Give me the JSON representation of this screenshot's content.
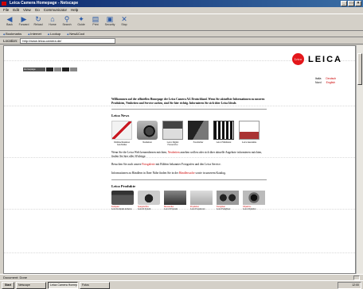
{
  "window": {
    "title": "Leica Camera Homepage - Netscape"
  },
  "menu": [
    "File",
    "Edit",
    "View",
    "Go",
    "Communicator",
    "Help"
  ],
  "toolbar": [
    {
      "label": "Back",
      "icon": "back-icon",
      "glyph": "◀"
    },
    {
      "label": "Forward",
      "icon": "forward-icon",
      "glyph": "▶"
    },
    {
      "label": "Reload",
      "icon": "reload-icon",
      "glyph": "↻"
    },
    {
      "label": "Home",
      "icon": "home-icon",
      "glyph": "⌂"
    },
    {
      "label": "Search",
      "icon": "search-icon",
      "glyph": "⚲"
    },
    {
      "label": "Guide",
      "icon": "guide-icon",
      "glyph": "✦"
    },
    {
      "label": "Print",
      "icon": "print-icon",
      "glyph": "▤"
    },
    {
      "label": "Security",
      "icon": "lock-icon",
      "glyph": "▣"
    },
    {
      "label": "Stop",
      "icon": "stop-icon",
      "glyph": "✕"
    }
  ],
  "links_bar": [
    "Bookmarks",
    "Internet",
    "Lookup",
    "New&Cool"
  ],
  "address": {
    "label": "Location:",
    "value": "http://www.leica-camera.de/"
  },
  "brand": {
    "name": "LEICA",
    "badge": "Leica"
  },
  "nav": {
    "first_label": "Homepage"
  },
  "languages": [
    [
      "Italia",
      "Deutsch"
    ],
    [
      "Nord",
      "English"
    ]
  ],
  "intro": "Willkommen auf der offiziellen Homepage der Leica Camera AG Deutschland. Wenn Sie aktuellste Informationen zu unseren Produkten, Neuheiten und Service suchen, sind Sie hier richtig. Informieren Sie sich über Leica Ideale.",
  "news": {
    "heading": "Leica News",
    "items": [
      {
        "caption": "Weihnachtsaktion Geschenke",
        "img": "img-gift"
      },
      {
        "caption": "Neuheiten",
        "img": "img-camera"
      },
      {
        "caption": "Leica Digital Fotoservice",
        "img": "img-printer"
      },
      {
        "caption": "Fotobücher",
        "img": "img-album"
      },
      {
        "caption": "Leica Filmdienst",
        "img": "img-film"
      },
      {
        "caption": "Leica Akademie",
        "img": "img-doc"
      }
    ]
  },
  "body_text": [
    {
      "pre": "Wenn Sie die Leica Welt kennenlernen möchten, ",
      "link": "Neuheiten",
      "post": " ansehen wollen oder sich über aktuelle Angebote informieren möchten, finden Sie hier alles Wichtige."
    },
    {
      "pre": "Besuchen Sie auch unsere ",
      "link": "Fotogalerie",
      "post": " mit Bildern bekannter Fotografen und den Leica Service."
    },
    {
      "pre": "Informationen zu Händlern in Ihrer Nähe finden Sie in der ",
      "link": "Händlersuche",
      "post": " sowie in unserem Katalog."
    }
  ],
  "products": {
    "heading": "Leica Produkte",
    "items": [
      {
        "name": "Kompakt",
        "sub": "Leica Kompakt-kameras",
        "img": "p1"
      },
      {
        "name": "Spiegelreflex",
        "sub": "Leica R System",
        "img": "p2"
      },
      {
        "name": "Messsucher",
        "sub": "Leica M System",
        "img": "p3"
      },
      {
        "name": "Projektion",
        "sub": "Leica Projektoren",
        "img": "p4"
      },
      {
        "name": "Ferngläser",
        "sub": "Leica Ferngläser",
        "img": "p5"
      },
      {
        "name": "Objektive",
        "sub": "Leica Objektive",
        "img": "p6"
      }
    ]
  },
  "status": {
    "text": "Document: Done",
    "zone": ""
  },
  "taskbar": {
    "start": "Start",
    "tasks": [
      "Netscape",
      "Leica Camera Homepage",
      "Fotos"
    ],
    "clock": "12:00"
  }
}
